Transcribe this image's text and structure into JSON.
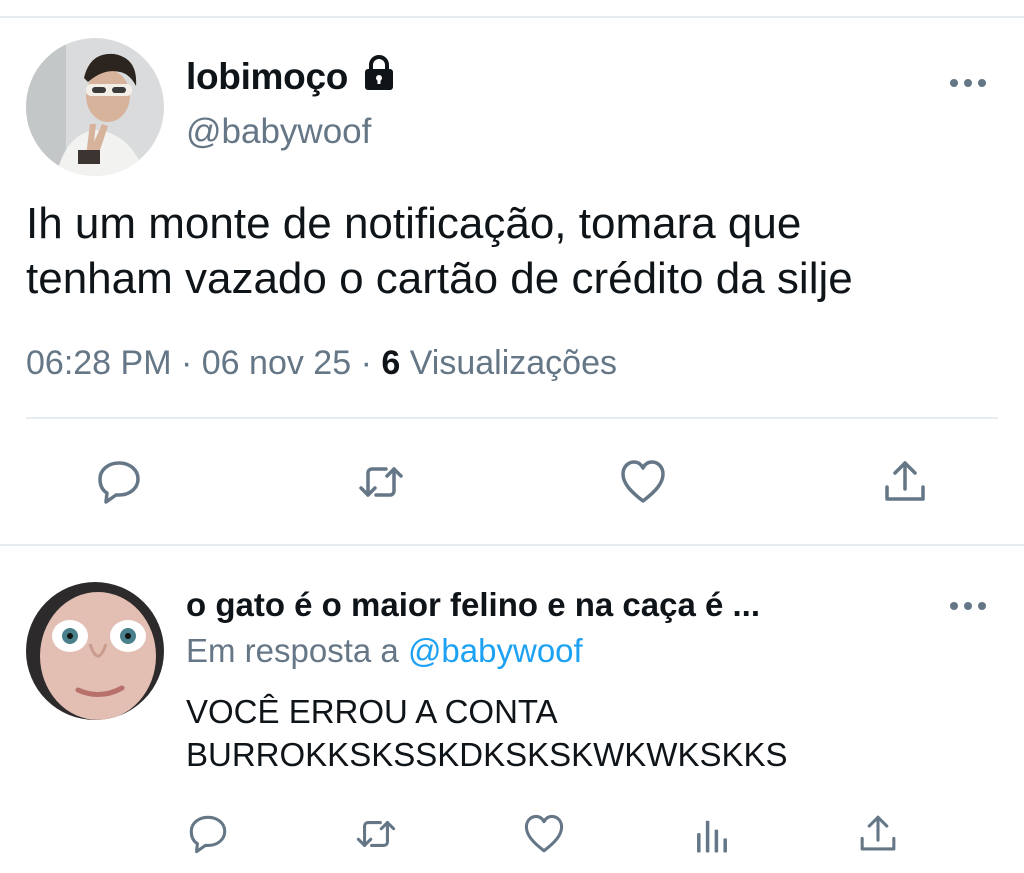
{
  "colors": {
    "text_primary": "#0f1419",
    "text_secondary": "#657786",
    "link": "#1da1f2",
    "divider": "#e6ecf0",
    "icon": "#657786"
  },
  "main_tweet": {
    "display_name": "lobimoço",
    "protected_icon": "lock-icon",
    "handle": "@babywoof",
    "more_icon": "more-horizontal-icon",
    "text_lines": [
      "Ih um monte de notificação, tomara que",
      "tenham vazado o cartão de crédito da silje"
    ],
    "time": "06:28 PM",
    "separator": "·",
    "date": "06 nov 25",
    "views_count": "6",
    "views_label": "Visualizações",
    "actions": [
      {
        "name": "reply",
        "icon": "comment-icon"
      },
      {
        "name": "retweet",
        "icon": "retweet-icon"
      },
      {
        "name": "like",
        "icon": "heart-icon"
      },
      {
        "name": "share",
        "icon": "share-icon"
      }
    ]
  },
  "reply_tweet": {
    "display_name": "o gato é o maior felino e na caça é ...",
    "in_reply_prefix": "Em resposta a",
    "in_reply_handle": "@babywoof",
    "text_lines": [
      "VOCÊ ERROU A CONTA",
      "BURROKKSKSSKDKSKSKWKWKSKKS"
    ],
    "more_icon": "more-horizontal-icon",
    "actions": [
      {
        "name": "reply",
        "icon": "comment-icon"
      },
      {
        "name": "retweet",
        "icon": "retweet-icon"
      },
      {
        "name": "like",
        "icon": "heart-icon"
      },
      {
        "name": "analytics",
        "icon": "analytics-icon"
      },
      {
        "name": "share",
        "icon": "share-icon"
      }
    ]
  }
}
